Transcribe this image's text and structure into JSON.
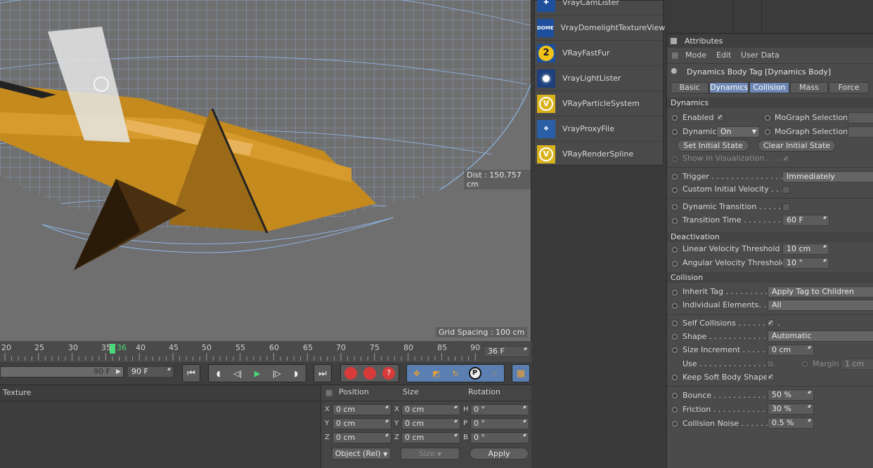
{
  "viewport": {
    "dist_label": "Dist : 150.757 cm",
    "grid_label": "Grid Spacing : 100 cm"
  },
  "plugins": [
    {
      "label": "VrayCamLister",
      "icon": "camera-lister-icon",
      "color": "#1d4f9c"
    },
    {
      "label": "VrayDomelightTextureView",
      "icon": "dome-icon",
      "icon_text": "DOME",
      "color": "#1d4f9c"
    },
    {
      "label": "VRayFastFur",
      "icon": "fastfur-icon",
      "icon_text": "2",
      "color": "#f2c21b"
    },
    {
      "label": "VrayLightLister",
      "icon": "light-lister-icon",
      "color": "#1d3f7c"
    },
    {
      "label": "VRayParticleSystem",
      "icon": "vray-logo-icon",
      "color": "#d9b21d"
    },
    {
      "label": "VrayProxyFile",
      "icon": "proxy-file-icon",
      "color": "#2a5fa8"
    },
    {
      "label": "VRayRenderSpline",
      "icon": "vray-logo-icon",
      "color": "#d9b21d"
    }
  ],
  "attributes": {
    "title": "Attributes",
    "menu": [
      "Mode",
      "Edit",
      "User Data"
    ],
    "object_title": "Dynamics Body Tag [Dynamics Body]",
    "tabs": [
      "Basic",
      "Dynamics",
      "Collision",
      "Mass",
      "Force"
    ],
    "active_tabs": [
      "Dynamics",
      "Collision"
    ],
    "dynamics": {
      "section": "Dynamics",
      "enabled_label": "Enabled",
      "enabled_value": "✓",
      "mograph_label": "MoGraph Selection",
      "dynamic_label": "Dynamic",
      "dynamic_value": "On",
      "set_initial": "Set Initial State",
      "clear_initial": "Clear Initial State",
      "show_vis_label": "Show in Visualization . . . . .",
      "show_vis_value": "✓",
      "trigger_label": "Trigger . . . . . . . . . . . . . . .",
      "trigger_value": "Immediately",
      "custom_vel_label": "Custom Initial Velocity . . . .",
      "dyn_transition_label": "Dynamic Transition . . . . . . .",
      "transition_time_label": "Transition Time . . . . . . . . . .",
      "transition_time_value": "60 F"
    },
    "deactivation": {
      "section": "Deactivation",
      "linear_label": "Linear Velocity Threshold",
      "linear_value": "10 cm",
      "angular_label": "Angular Velocity Threshold",
      "angular_value": "10 °"
    },
    "collision": {
      "section": "Collision",
      "inherit_label": "Inherit Tag . . . . . . . . . . . . .",
      "inherit_value": "Apply Tag to Children",
      "individual_label": "Individual Elements. . . . . .",
      "individual_value": "All",
      "self_label": "Self Collisions . . . . . . . . .",
      "self_value": "✓",
      "shape_label": "Shape . . . . . . . . . . . . . . . .",
      "shape_value": "Automatic",
      "size_inc_label": "Size Increment . . . . . . . .",
      "size_inc_value": "0 cm",
      "use_label": "Use . . . . . . . . . . . . . . . .",
      "margin_label": "Margin",
      "margin_value": "1 cm",
      "keep_soft_label": "Keep Soft Body Shape",
      "keep_soft_value": "✓",
      "bounce_label": "Bounce . . . . . . . . . . . . . .",
      "bounce_value": "50 %",
      "friction_label": "Friction . . . . . . . . . . . . . .",
      "friction_value": "30 %",
      "noise_label": "Collision Noise . . . . . .",
      "noise_value": "0.5 %"
    }
  },
  "timeline": {
    "ticks": [
      "20",
      "25",
      "30",
      "35",
      "36",
      "40",
      "45",
      "50",
      "55",
      "60",
      "65",
      "70",
      "75",
      "80",
      "85",
      "90"
    ],
    "current_frame": "36",
    "frame_field": "36 F",
    "end_slider": "90 F",
    "end_field": "90 F"
  },
  "material": {
    "texture_label": "Texture"
  },
  "coords": {
    "headers": [
      "Position",
      "Size",
      "Rotation"
    ],
    "rows": [
      {
        "a": "X",
        "pos": "0 cm",
        "b": "X",
        "size": "0 cm",
        "c": "H",
        "rot": "0 °"
      },
      {
        "a": "Y",
        "pos": "0 cm",
        "b": "Y",
        "size": "0 cm",
        "c": "P",
        "rot": "0 °"
      },
      {
        "a": "Z",
        "pos": "0 cm",
        "b": "Z",
        "size": "0 cm",
        "c": "B",
        "rot": "0 °"
      }
    ],
    "mode": "Object (Rel)",
    "size_mode": "Size",
    "apply": "Apply"
  }
}
